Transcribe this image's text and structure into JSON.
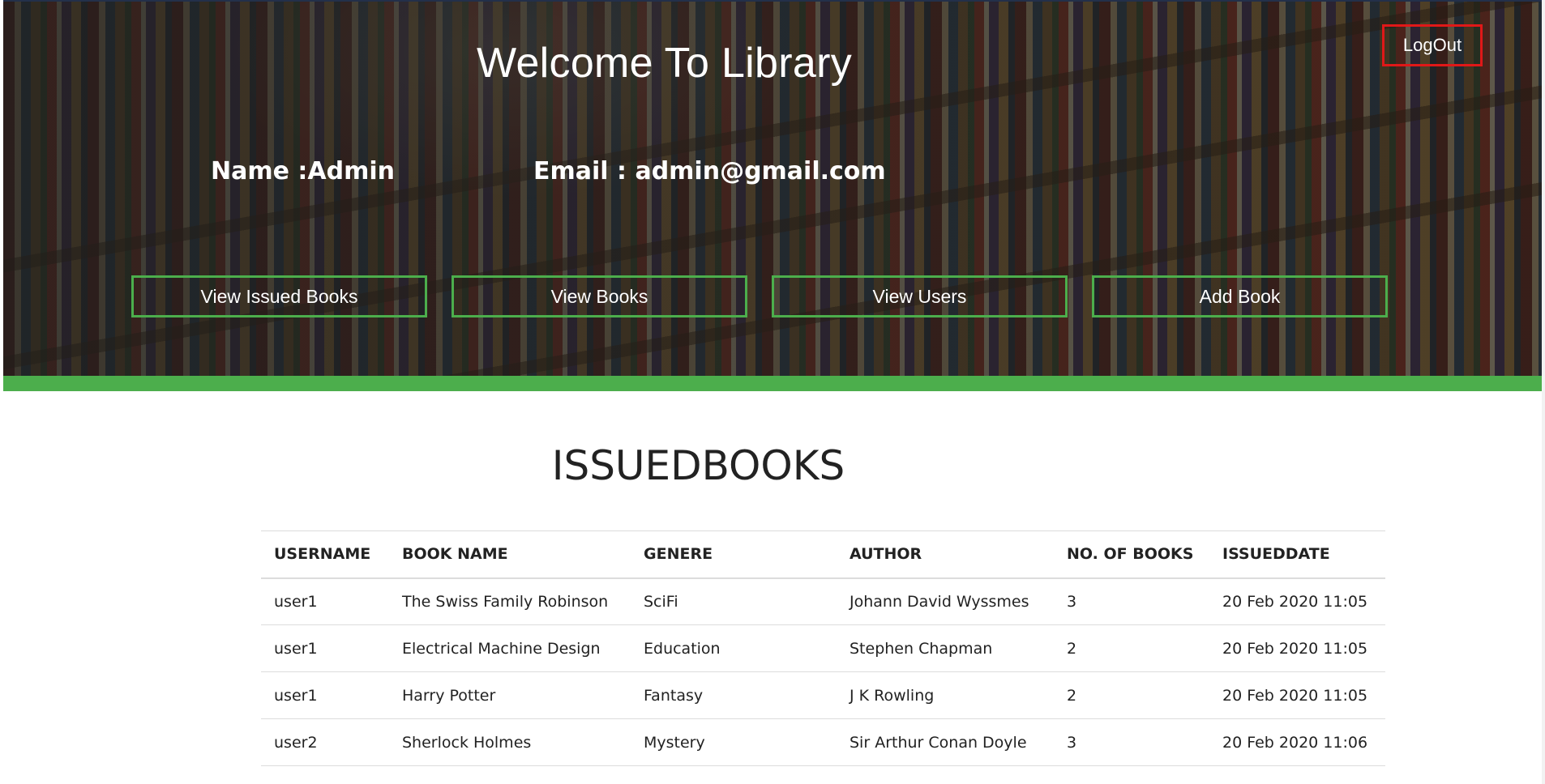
{
  "header": {
    "title": "Welcome To Library",
    "logout_label": "LogOut",
    "profile": {
      "name_text": "Name :Admin",
      "email_text": "Email :  admin@gmail.com"
    },
    "nav": [
      {
        "label": "View Issued Books"
      },
      {
        "label": "View Books"
      },
      {
        "label": "View Users"
      },
      {
        "label": "Add Book"
      }
    ]
  },
  "main": {
    "section_title": "ISSUEDBOOKS",
    "table": {
      "columns": [
        "USERNAME",
        "BOOK NAME",
        "GENERE",
        "AUTHOR",
        "NO. OF BOOKS",
        "ISSUEDDATE"
      ],
      "rows": [
        [
          "user1",
          "The Swiss Family Robinson",
          "SciFi",
          "Johann David Wyssmes",
          "3",
          "20 Feb 2020 11:05"
        ],
        [
          "user1",
          "Electrical Machine Design",
          "Education",
          "Stephen Chapman",
          "2",
          "20 Feb 2020 11:05"
        ],
        [
          "user1",
          "Harry Potter",
          "Fantasy",
          "J K Rowling",
          "2",
          "20 Feb 2020 11:05"
        ],
        [
          "user2",
          "Sherlock Holmes",
          "Mystery",
          "Sir Arthur Conan Doyle",
          "3",
          "20 Feb 2020 11:06"
        ]
      ]
    }
  },
  "colors": {
    "accent_green": "#4cae4c",
    "logout_red": "#e01818",
    "text_dark": "#222222"
  }
}
